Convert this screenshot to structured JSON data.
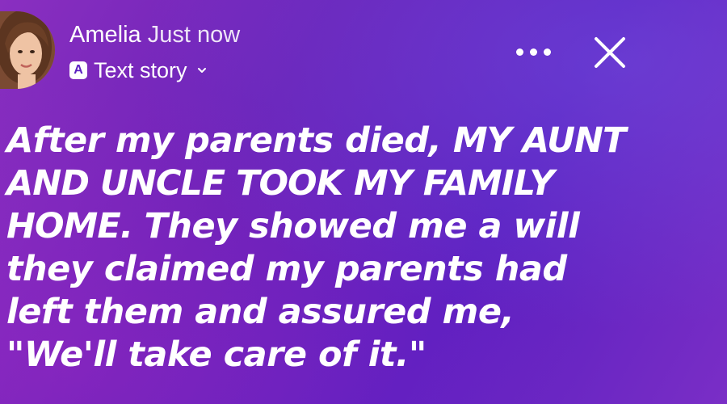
{
  "header": {
    "user_name": "Amelia",
    "timestamp": "Just now",
    "story_type_badge": "A",
    "story_type_label": "Text story",
    "more_icon": "more-horizontal-icon",
    "close_icon": "close-icon"
  },
  "story": {
    "line1_normal": "After my parents died, ",
    "line1_caps": "MY AUNT",
    "line2_caps": "AND UNCLE TOOK MY FAMILY",
    "line3_caps": "HOME.",
    "line3_normal": " They showed me a will",
    "line4": "they claimed my parents had",
    "line5": "left them and assured me,",
    "line6_quote": "\"We'll take care of it.\""
  },
  "colors": {
    "background_start": "#8a2fc0",
    "background_end": "#5a1fc0",
    "text": "#ffffff"
  }
}
